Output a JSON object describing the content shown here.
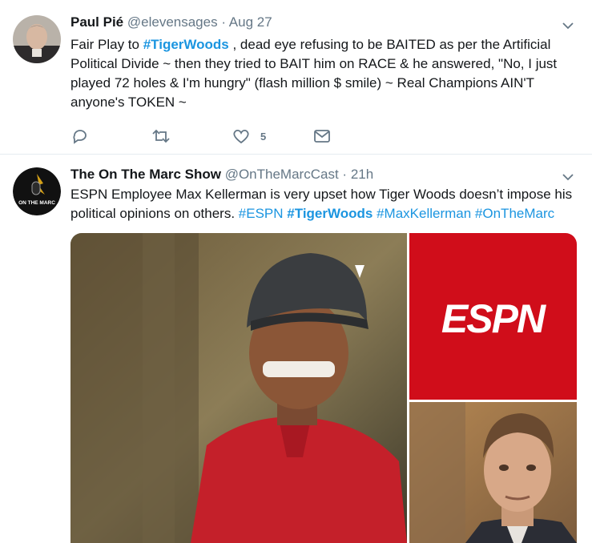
{
  "tweets": [
    {
      "name": "Paul Pié",
      "handle": "@elevensages",
      "sep": "·",
      "time": "Aug 27",
      "text_parts": [
        "Fair Play to ",
        "#TigerWoods",
        " , dead eye refusing to be BAITED as per the Artificial Political Divide ~ then they tried to BAIT him on RACE & he answered, \"No, I just played 72 holes & I'm hungry\" (flash million $ smile) ~ Real Champions AIN'T anyone's TOKEN ~"
      ],
      "like_count": "5"
    },
    {
      "name": "The On The Marc Show",
      "handle": "@OnTheMarcCast",
      "sep": "·",
      "time": "21h",
      "text_plain": "ESPN Employee Max Kellerman is very upset how Tiger Woods doesn’t impose his political opinions on others. ",
      "hashtags": [
        "#ESPN",
        "#TigerWoods",
        "#MaxKellerman",
        "#OnTheMarc"
      ],
      "avatar_text": "ON THE MARC",
      "media_logo": "ESPN"
    }
  ],
  "colors": {
    "link": "#1b95e0",
    "muted": "#657786",
    "espn_red": "#d00d1a"
  }
}
